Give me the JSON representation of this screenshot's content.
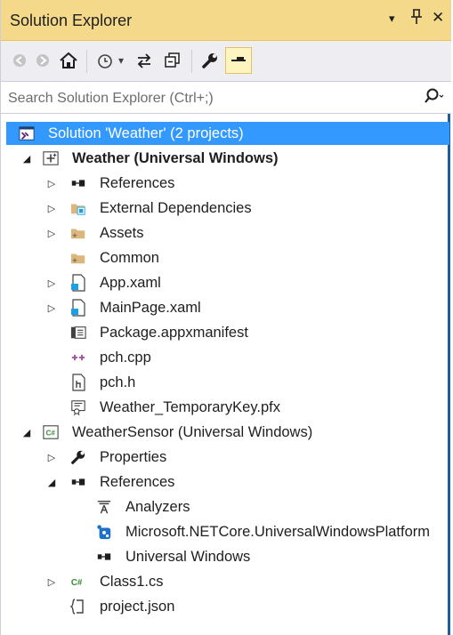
{
  "panel": {
    "title": "Solution Explorer",
    "dropdown_glyph": "▾",
    "pin_glyph": "ᐅ",
    "close_glyph": "✕"
  },
  "toolbar": {
    "back_glyph": "◉",
    "forward_glyph": "◉",
    "home_glyph": "⌂",
    "history_glyph": "◔",
    "history_dropdown_glyph": "▾",
    "sync_glyph": "⇆",
    "collapse_glyph": "⧉",
    "properties_glyph": "🔧",
    "preview_glyph": "▬"
  },
  "search": {
    "placeholder": "Search Solution Explorer (Ctrl+;)",
    "button_glyph": "⌕"
  },
  "tree": {
    "solution": "Solution 'Weather' (2 projects)",
    "items": [
      {
        "label": "Weather (Universal Windows)",
        "icon": "cpp-project-icon",
        "expander": "expanded"
      },
      {
        "label": "References",
        "icon": "references-icon",
        "expander": "collapsed"
      },
      {
        "label": "External Dependencies",
        "icon": "external-dependencies-icon",
        "expander": "collapsed"
      },
      {
        "label": "Assets",
        "icon": "folder-icon",
        "expander": "collapsed"
      },
      {
        "label": "Common",
        "icon": "folder-icon",
        "expander": "none"
      },
      {
        "label": "App.xaml",
        "icon": "xaml-file-icon",
        "expander": "collapsed"
      },
      {
        "label": "MainPage.xaml",
        "icon": "xaml-file-icon",
        "expander": "collapsed"
      },
      {
        "label": "Package.appxmanifest",
        "icon": "manifest-icon",
        "expander": "none"
      },
      {
        "label": "pch.cpp",
        "icon": "cpp-file-icon",
        "expander": "none"
      },
      {
        "label": "pch.h",
        "icon": "header-file-icon",
        "expander": "none"
      },
      {
        "label": "Weather_TemporaryKey.pfx",
        "icon": "certificate-icon",
        "expander": "none"
      },
      {
        "label": "WeatherSensor (Universal Windows)",
        "icon": "csharp-project-icon",
        "expander": "expanded"
      },
      {
        "label": "Properties",
        "icon": "wrench-icon",
        "expander": "collapsed"
      },
      {
        "label": "References",
        "icon": "references-icon",
        "expander": "expanded"
      },
      {
        "label": "Analyzers",
        "icon": "analyzers-icon",
        "expander": "none"
      },
      {
        "label": "Microsoft.NETCore.UniversalWindowsPlatform",
        "icon": "nuget-package-icon",
        "expander": "none"
      },
      {
        "label": "Universal Windows",
        "icon": "references-icon",
        "expander": "none"
      },
      {
        "label": "Class1.cs",
        "icon": "csharp-file-icon",
        "expander": "collapsed"
      },
      {
        "label": "project.json",
        "icon": "json-file-icon",
        "expander": "none"
      }
    ]
  },
  "colors": {
    "title_bar": "#f5d98a",
    "selection": "#3399ff",
    "toolbar": "#eeeef2"
  }
}
